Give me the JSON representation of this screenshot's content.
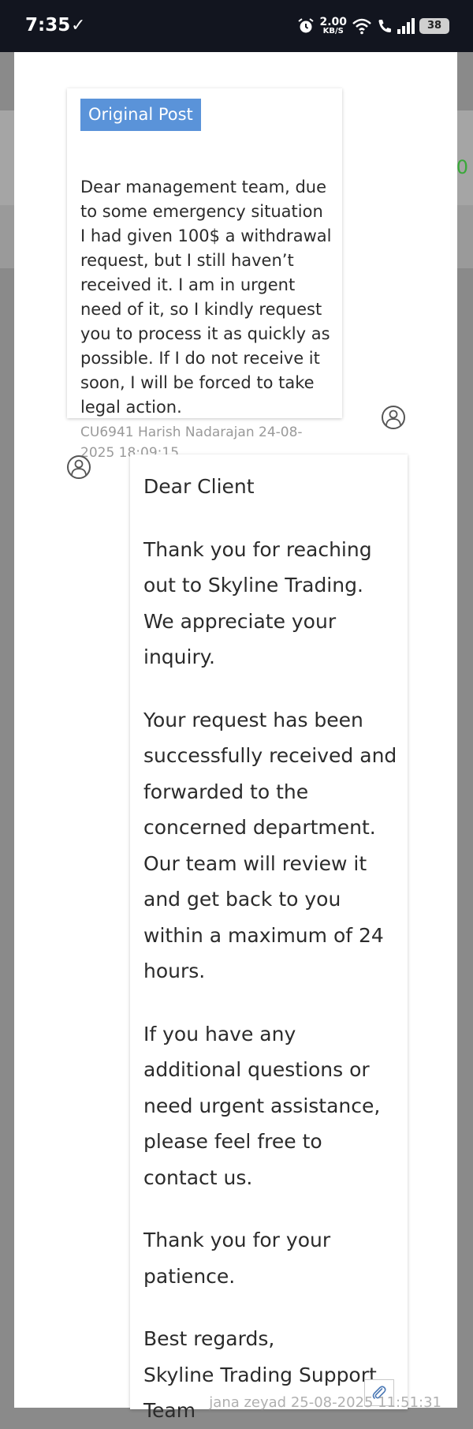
{
  "status_bar": {
    "time": "7:35",
    "check_glyph": "✓",
    "speed_value": "2.00",
    "speed_unit": "KB/S",
    "battery": "38",
    "icons": [
      "alarm-icon",
      "wifi-icon",
      "wifi-calling-icon",
      "signal-icon",
      "battery-icon"
    ]
  },
  "background": {
    "edge_text": "0"
  },
  "original_post": {
    "badge": "Original Post",
    "body": "Dear management team, due to some emergency situation I had given 100$ a withdrawal request, but I still haven’t received it. I am in urgent need of it, so I kindly request you to process it as quickly as possible. If I do not receive it soon, I will be forced to take legal action.",
    "meta": "CU6941 Harish Nadarajan 24-08-2025 18:09:15"
  },
  "reply": {
    "greeting": "Dear Client",
    "p1": "Thank you for reaching out to Skyline Trading. We appreciate your inquiry.",
    "p2": "Your request has been successfully received and forwarded to the concerned department. Our team will review it and get back to you within a maximum of 24 hours.",
    "p3": "If you have any additional questions or need urgent assistance, please feel free to contact us.",
    "p4": "Thank you for your patience.",
    "sign_line1": "Best regards,",
    "sign_line2": "Skyline Trading Support Team",
    "meta": "jana zeyad 25-08-2025 11:51:31"
  },
  "colors": {
    "badge": "#5a93d9",
    "status_bar": "#12151f",
    "meta_text": "#9a9a9a"
  }
}
